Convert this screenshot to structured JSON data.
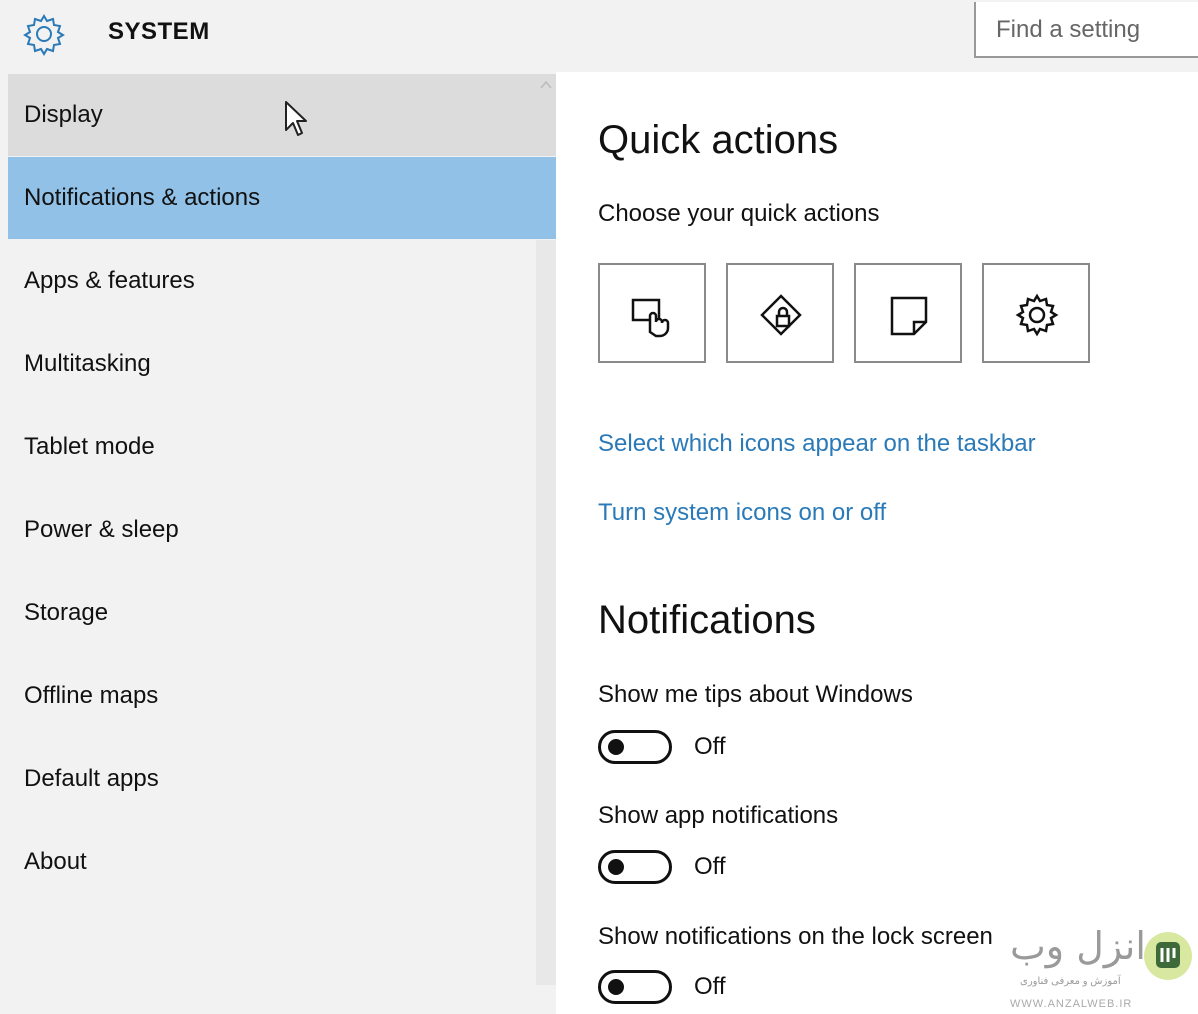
{
  "header": {
    "title": "SYSTEM",
    "search_placeholder": "Find a setting"
  },
  "sidebar": {
    "items": [
      {
        "label": "Display"
      },
      {
        "label": "Notifications & actions"
      },
      {
        "label": "Apps & features"
      },
      {
        "label": "Multitasking"
      },
      {
        "label": "Tablet mode"
      },
      {
        "label": "Power & sleep"
      },
      {
        "label": "Storage"
      },
      {
        "label": "Offline maps"
      },
      {
        "label": "Default apps"
      },
      {
        "label": "About"
      }
    ],
    "selected_index": 1
  },
  "main": {
    "quick_actions_heading": "Quick actions",
    "quick_actions_sub": "Choose your quick actions",
    "quick_action_icons": [
      "tablet-mode-icon",
      "location-lock-icon",
      "note-icon",
      "settings-gear-icon"
    ],
    "link_taskbar_icons": "Select which icons appear on the taskbar",
    "link_system_icons": "Turn system icons on or off",
    "notifications_heading": "Notifications",
    "settings": [
      {
        "label": "Show me tips about Windows",
        "state": "Off"
      },
      {
        "label": "Show app notifications",
        "state": "Off"
      },
      {
        "label": "Show notifications on the lock screen",
        "state": "Off"
      }
    ]
  },
  "watermark": {
    "brand": "انزل وب",
    "tagline": "آموزش و معرفی فناوری",
    "url": "WWW.ANZALWEB.IR"
  },
  "colors": {
    "selected_nav": "#91c1e7",
    "hover_nav": "#dcdcdc",
    "link": "#2a7ab8",
    "sidebar_bg": "#f2f2f2"
  }
}
